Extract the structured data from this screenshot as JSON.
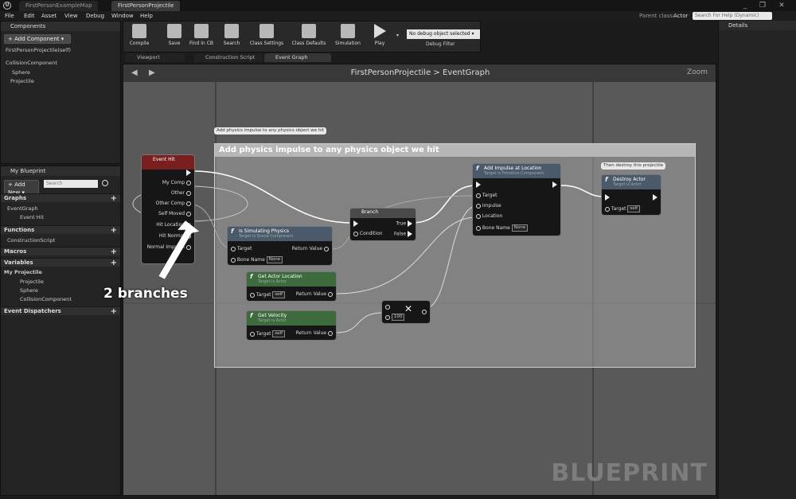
{
  "titlebar": {
    "tabs": [
      "FirstPersonExampleMap",
      "FirstPersonProjectile"
    ],
    "window_buttons": [
      "_",
      "❐",
      "✕"
    ]
  },
  "menu": [
    "File",
    "Edit",
    "Asset",
    "View",
    "Debug",
    "Window",
    "Help"
  ],
  "parent_class": {
    "label": "Parent class:",
    "value": "Actor"
  },
  "search_help_placeholder": "Search For Help (Dynamic)",
  "components_panel": {
    "title": "Components",
    "add_button": "+ Add Component ▾",
    "self_item": "FirstPersonProjectile(self)",
    "items": [
      "CollisionComponent",
      "Sphere",
      "Projectile"
    ]
  },
  "toolbar": {
    "buttons": [
      "Compile",
      "Save",
      "Find in CB",
      "Search",
      "Class Settings",
      "Class Defaults",
      "Simulation",
      "Play"
    ],
    "debug_select": "No debug object selected ▾",
    "debug_label": "Debug Filter"
  },
  "editor_tabs": [
    "Viewport",
    "Construction Script",
    "Event Graph"
  ],
  "my_blueprint": {
    "title": "My Blueprint",
    "add_new": "+ Add New ▾",
    "search_placeholder": "Search",
    "sections": {
      "graphs": "Graphs",
      "event_graph": "EventGraph",
      "event_hit": "Event Hit",
      "functions": "Functions",
      "construction_script": "ConstructionScript",
      "macros": "Macros",
      "variables": "Variables",
      "my_projectile": "My Projectile",
      "vars": [
        "Projectile",
        "Sphere",
        "CollisionComponent"
      ],
      "event_dispatchers": "Event Dispatchers"
    }
  },
  "graph": {
    "breadcrumb_root": "FirstPersonProjectile",
    "breadcrumb_sep": ">",
    "breadcrumb_leaf": "EventGraph",
    "zoom": "Zoom",
    "comment_bubble": "Add physics impulse to any physics object we hit",
    "comment_title": "Add physics impulse to any physics object we hit",
    "destroy_bubble": "Then destroy this projectile",
    "watermark": "BLUEPRINT"
  },
  "nodes": {
    "event_hit": {
      "title": "Event Hit",
      "pins": [
        "My Comp",
        "Other",
        "Other Comp",
        "Self Moved",
        "Hit Location",
        "Hit Normal",
        "Normal Impulse"
      ]
    },
    "branch": {
      "title": "Branch",
      "condition": "Condition",
      "true": "True",
      "false": "False"
    },
    "is_simulating": {
      "title": "Is Simulating Physics",
      "sub": "Target is Scene Component",
      "target": "Target",
      "bone": "Bone Name",
      "bone_val": "None",
      "ret": "Return Value"
    },
    "add_impulse": {
      "title": "Add Impulse at Location",
      "sub": "Target is Primitive Component",
      "pins": [
        "Target",
        "Impulse",
        "Location"
      ],
      "bone": "Bone Name",
      "bone_val": "None"
    },
    "destroy": {
      "title": "Destroy Actor",
      "sub": "Target is Actor",
      "target": "Target",
      "target_val": "self"
    },
    "get_location": {
      "title": "Get Actor Location",
      "sub": "Target is Actor",
      "target": "Target",
      "target_val": "self",
      "ret": "Return Value"
    },
    "get_velocity": {
      "title": "Get Velocity",
      "sub": "Target is Actor",
      "target": "Target",
      "target_val": "self",
      "ret": "Return Value"
    },
    "multiply": {
      "value": "100",
      "symbol": "✕"
    }
  },
  "annotation": "2 branches",
  "details": {
    "title": "Details"
  }
}
